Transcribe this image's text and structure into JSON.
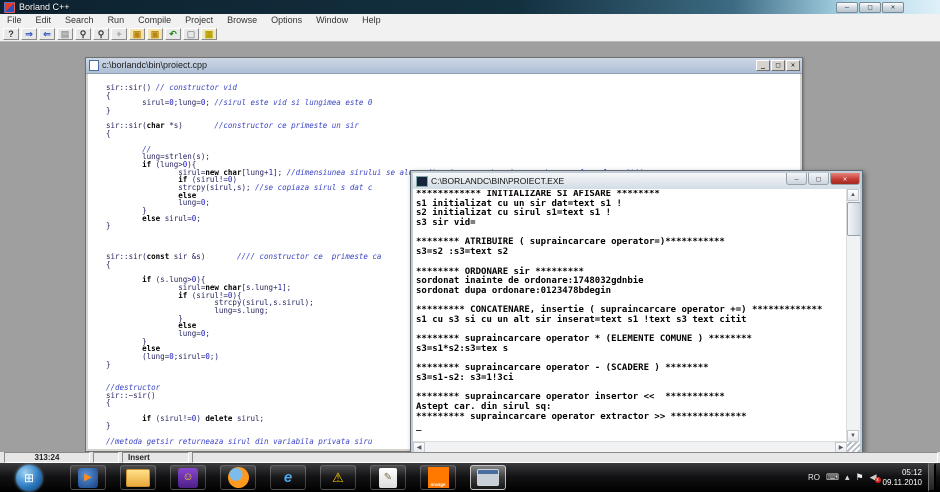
{
  "window": {
    "title": "Borland C++",
    "controls": [
      {
        "name": "minimize-button",
        "glyph": "–"
      },
      {
        "name": "maximize-button",
        "glyph": "□"
      },
      {
        "name": "close-button",
        "glyph": "✕"
      }
    ]
  },
  "menu": {
    "items": [
      "File",
      "Edit",
      "Search",
      "Run",
      "Compile",
      "Project",
      "Browse",
      "Options",
      "Window",
      "Help"
    ]
  },
  "toolbar": {
    "icons": [
      {
        "name": "help-icon",
        "glyph": "?"
      },
      {
        "name": "open-file-icon",
        "glyph": "⇒"
      },
      {
        "name": "save-file-icon",
        "glyph": "⇐"
      },
      {
        "name": "print-icon",
        "glyph": "▤"
      },
      {
        "name": "search-icon",
        "glyph": "⚲"
      },
      {
        "name": "search-again-icon",
        "glyph": "⚲"
      },
      {
        "name": "add-item-icon",
        "glyph": "+"
      },
      {
        "name": "open-project-icon",
        "glyph": "▣"
      },
      {
        "name": "close-project-icon",
        "glyph": "▣"
      },
      {
        "name": "undo-icon",
        "glyph": "↶"
      },
      {
        "name": "window-icon",
        "glyph": "▢"
      },
      {
        "name": "run-icon",
        "glyph": "▦"
      }
    ]
  },
  "editor": {
    "title": "c:\\borlandc\\bin\\proiect.cpp",
    "controls": [
      {
        "name": "minimize-button",
        "glyph": "_"
      },
      {
        "name": "maximize-button",
        "glyph": "□"
      },
      {
        "name": "close-button",
        "glyph": "✕"
      }
    ],
    "code": [
      [
        [
          "p",
          "sir::sir() "
        ],
        [
          "c",
          "// constructor vid"
        ]
      ],
      [
        [
          "p",
          "{"
        ]
      ],
      [
        [
          "p",
          "        sirul="
        ],
        [
          "n",
          "0"
        ],
        [
          "p",
          ";lung="
        ],
        [
          "n",
          "0"
        ],
        [
          "p",
          "; "
        ],
        [
          "c",
          "//sirul este vid si lungimea este 0"
        ]
      ],
      [
        [
          "p",
          "}"
        ]
      ],
      [],
      [
        [
          "p",
          "sir::sir("
        ],
        [
          "k",
          "char"
        ],
        [
          "p",
          " *s)       "
        ],
        [
          "c",
          "//constructor ce primeste un sir"
        ]
      ],
      [
        [
          "p",
          "{"
        ]
      ],
      [],
      [
        [
          "p",
          "        "
        ],
        [
          "c",
          "//"
        ]
      ],
      [
        [
          "p",
          "        lung=strlen(s);"
        ]
      ],
      [
        [
          "p",
          "        "
        ],
        [
          "k",
          "if"
        ],
        [
          "p",
          " (lung>"
        ],
        [
          "n",
          "0"
        ],
        [
          "p",
          "){"
        ]
      ],
      [
        [
          "p",
          "                sirul="
        ],
        [
          "k",
          "new"
        ],
        [
          "p",
          " "
        ],
        [
          "k",
          "char"
        ],
        [
          "p",
          "[lung+"
        ],
        [
          "n",
          "1"
        ],
        [
          "p",
          "]; "
        ],
        [
          "c",
          "//dimensiunea sirului se aloca dinamic...vvector de caractere cu lung+1 pozitii"
        ]
      ],
      [
        [
          "p",
          "                "
        ],
        [
          "k",
          "if"
        ],
        [
          "p",
          " (sirul!="
        ],
        [
          "n",
          "0"
        ],
        [
          "p",
          ")"
        ]
      ],
      [
        [
          "p",
          "                strcpy(sirul,s); "
        ],
        [
          "c",
          "//se copiaza sirul s dat c"
        ]
      ],
      [
        [
          "p",
          "                "
        ],
        [
          "k",
          "else"
        ]
      ],
      [
        [
          "p",
          "                lung="
        ],
        [
          "n",
          "0"
        ],
        [
          "p",
          ";"
        ]
      ],
      [
        [
          "p",
          "        }"
        ]
      ],
      [
        [
          "p",
          "        "
        ],
        [
          "k",
          "else"
        ],
        [
          "p",
          " sirul="
        ],
        [
          "n",
          "0"
        ],
        [
          "p",
          ";"
        ]
      ],
      [
        [
          "p",
          "}"
        ]
      ],
      [],
      [],
      [],
      [
        [
          "p",
          "sir::sir("
        ],
        [
          "k",
          "const"
        ],
        [
          "p",
          " sir &s)       "
        ],
        [
          "c",
          "//// constructor ce  primeste ca"
        ]
      ],
      [
        [
          "p",
          "{"
        ]
      ],
      [],
      [
        [
          "p",
          "        "
        ],
        [
          "k",
          "if"
        ],
        [
          "p",
          " (s.lung>"
        ],
        [
          "n",
          "0"
        ],
        [
          "p",
          "){"
        ]
      ],
      [
        [
          "p",
          "                sirul="
        ],
        [
          "k",
          "new"
        ],
        [
          "p",
          " "
        ],
        [
          "k",
          "char"
        ],
        [
          "p",
          "[s.lung+"
        ],
        [
          "n",
          "1"
        ],
        [
          "p",
          "];"
        ]
      ],
      [
        [
          "p",
          "                "
        ],
        [
          "k",
          "if"
        ],
        [
          "p",
          " (sirul!="
        ],
        [
          "n",
          "0"
        ],
        [
          "p",
          "){"
        ]
      ],
      [
        [
          "p",
          "                        strcpy(sirul,s.sirul);"
        ]
      ],
      [
        [
          "p",
          "                        lung=s.lung;"
        ]
      ],
      [
        [
          "p",
          "                }"
        ]
      ],
      [
        [
          "p",
          "                "
        ],
        [
          "k",
          "else"
        ]
      ],
      [
        [
          "p",
          "                lung="
        ],
        [
          "n",
          "0"
        ],
        [
          "p",
          ";"
        ]
      ],
      [
        [
          "p",
          "        }"
        ]
      ],
      [
        [
          "p",
          "        "
        ],
        [
          "k",
          "else"
        ]
      ],
      [
        [
          "p",
          "        (lung="
        ],
        [
          "n",
          "0"
        ],
        [
          "p",
          ";sirul="
        ],
        [
          "n",
          "0"
        ],
        [
          "p",
          ";)"
        ]
      ],
      [
        [
          "p",
          "}"
        ]
      ],
      [],
      [],
      [
        [
          "c",
          "//destructor"
        ]
      ],
      [
        [
          "p",
          "sir::~sir()"
        ]
      ],
      [
        [
          "p",
          "{"
        ]
      ],
      [],
      [
        [
          "p",
          "        "
        ],
        [
          "k",
          "if"
        ],
        [
          "p",
          " (sirul!="
        ],
        [
          "n",
          "0"
        ],
        [
          "p",
          ") "
        ],
        [
          "k",
          "delete"
        ],
        [
          "p",
          " sirul;"
        ]
      ],
      [
        [
          "p",
          "}"
        ]
      ],
      [],
      [
        [
          "c",
          "//metoda getsir returneaza sirul din variabila privata siru"
        ]
      ]
    ]
  },
  "console": {
    "title": "C:\\BORLANDC\\BIN\\PROIECT.EXE",
    "controls": [
      {
        "name": "minimize-button",
        "glyph": "–"
      },
      {
        "name": "maximize-button",
        "glyph": "□"
      },
      {
        "name": "close-button",
        "glyph": "✕"
      }
    ],
    "lines": [
      "************ INITIALIZARE SI AFISARE ********",
      "s1 initializat cu un sir dat=text s1 !",
      "s2 initializat cu sirul s1=text s1 !",
      "s3 sir vid=",
      "",
      "******** ATRIBUIRE ( supraincarcare operator=)***********",
      "s3=s2 :s3=text s2",
      "",
      "******** ORDONARE sir *********",
      "sordonat inainte de ordonare:1748032gdnbie",
      "sordonat dupa ordonare:0123478bdegin",
      "",
      "********* CONCATENARE, insertie ( supraincarcare operator +=) *************",
      "s1 cu s3 si cu un alt sir inserat=text s1 !text s3 text citit",
      "",
      "******** supraincarcare operator * (ELEMENTE COMUNE ) ********",
      "s3=s1*s2:s3=tex s",
      "",
      "******** supraincarcare operator - (SCADERE ) ********",
      "s3=s1-s2: s3=1!3ci",
      "",
      "******** supraincarcare operator insertor <<  ***********",
      "Astept car. din sirul sq:",
      "********* supraincarcare operator extractor >> **************",
      "_"
    ],
    "scrollbar": {
      "up_glyph": "▲",
      "down_glyph": "▼",
      "left_glyph": "◀",
      "right_glyph": "▶"
    }
  },
  "statusbar": {
    "position": "313:24",
    "mode": "Insert"
  },
  "taskbar": {
    "start_glyph": "⊞",
    "icons": [
      {
        "name": "start-orb"
      },
      {
        "name": "media-player-icon",
        "glyph": "▶"
      },
      {
        "name": "explorer-folder-icon",
        "glyph": ""
      },
      {
        "name": "yahoo-messenger-icon",
        "glyph": "☺"
      },
      {
        "name": "firefox-icon",
        "glyph": ""
      },
      {
        "name": "internet-explorer-icon",
        "glyph": "e"
      },
      {
        "name": "warning-app-icon",
        "glyph": "⚠"
      },
      {
        "name": "notes-icon",
        "glyph": "✎"
      },
      {
        "name": "orange-app-icon",
        "glyph": "orange"
      },
      {
        "name": "borland-taskbar-icon",
        "glyph": ""
      }
    ],
    "tray": {
      "language": "RO",
      "keyboard_glyph": "⌨",
      "expand_glyph": "▴",
      "flag_glyph": "⚑",
      "speaker_glyph": "◀",
      "time": "05:12",
      "date": "09.11.2010"
    }
  },
  "colors": {
    "workspace_gray": "#9f9f9f",
    "titlebar_dark": "#13303f",
    "close_red": "#c13a30",
    "comment_blue": "#3a44c4",
    "orange_brand": "#ff7900",
    "warning_yellow": "#ffcc00"
  }
}
